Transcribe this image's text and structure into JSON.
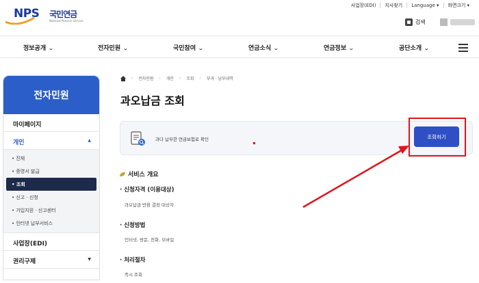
{
  "header": {
    "logo_text": "NPS",
    "logo_name": "국민연금",
    "logo_sub": "National Pension Service",
    "util_links": [
      "사업장(EDI)",
      "지사찾기",
      "Language ▾",
      "화면크기 ▾"
    ],
    "search_label": "검색"
  },
  "gnb": {
    "items": [
      "정보공개",
      "전자민원",
      "국민참여",
      "연금소식",
      "연금정보",
      "공단소개"
    ]
  },
  "sidebar": {
    "title": "전자민원",
    "mypage": "마이페이지",
    "personal": "개인",
    "sub_items": [
      "• 진체",
      "• 증명서 발급",
      "• 조회",
      "• 신고 · 신청",
      "• 가입지원 · 신고센터",
      "• 인터넷 납부서비스"
    ],
    "business": "사업장(EDI)",
    "rights": "권리구제"
  },
  "breadcrumb": [
    "전자민원",
    "개인",
    "조회",
    "부과 · 납부내역"
  ],
  "page": {
    "title": "과오납금 조회",
    "notice_text": "과다 납부한 연금보험료 확인",
    "query_button": "조회하기"
  },
  "overview": {
    "title": "서비스 개요",
    "sections": [
      {
        "title": "· 신청자격 (이용대상)",
        "desc": "과오납금 반환 결정 대상자"
      },
      {
        "title": "· 신청방법",
        "desc": "인터넷, 방문, 전화, 모바일"
      },
      {
        "title": "· 처리절차",
        "desc": "즉시 조회"
      }
    ]
  },
  "colors": {
    "brand_blue": "#2c5ec9",
    "button_blue": "#2f4fc4",
    "annotation_red": "#e0141b",
    "selected_nav": "#1d2a4a"
  }
}
